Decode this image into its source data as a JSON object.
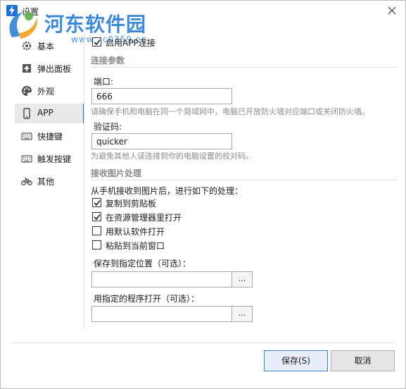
{
  "window": {
    "title": "设置"
  },
  "watermark": {
    "title": "河东软件园",
    "url": "www.pc0359.cn"
  },
  "sidebar": {
    "items": [
      {
        "label": "基本",
        "icon": "gear-icon"
      },
      {
        "label": "弹出面板",
        "icon": "popup-panel-icon"
      },
      {
        "label": "外观",
        "icon": "palette-icon"
      },
      {
        "label": "APP",
        "icon": "phone-icon",
        "active": true
      },
      {
        "label": "快捷键",
        "icon": "keyboard-icon"
      },
      {
        "label": "触发按键",
        "icon": "keyboard-icon"
      },
      {
        "label": "其他",
        "icon": "bicycle-icon"
      }
    ]
  },
  "app_settings": {
    "enable_app_connection": {
      "label": "启用APP连接",
      "checked": true
    },
    "connection_section": {
      "title": "连接参数",
      "port_label": "端口:",
      "port_value": "666",
      "port_hint": "请确保手机和电脑在同一个局域网中，电脑已开放防火墙对应端口或关闭防火墙。",
      "code_label": "验证码:",
      "code_value": "quicker",
      "code_hint": "为避免其他人误连接到你的电脑设置的校对码。"
    },
    "image_section": {
      "title": "接收图片处理",
      "description": "从手机接收到图片后，进行如下的处理：",
      "options": [
        {
          "label": "复制到剪贴板",
          "checked": true
        },
        {
          "label": "在资源管理器里打开",
          "checked": true
        },
        {
          "label": "用默认软件打开",
          "checked": false
        },
        {
          "label": "粘贴到当前窗口",
          "checked": false
        }
      ],
      "save_location_label": "保存到指定位置（可选）：",
      "save_location_value": "",
      "open_with_label": "用指定的程序打开（可选）：",
      "open_with_value": "",
      "browse_label": "..."
    }
  },
  "footer": {
    "save_label": "保存(S)",
    "cancel_label": "取消"
  },
  "colors": {
    "accent": "#1e6fd8",
    "watermark": "#2f7fd6",
    "section_title": "#8a8a8a"
  }
}
